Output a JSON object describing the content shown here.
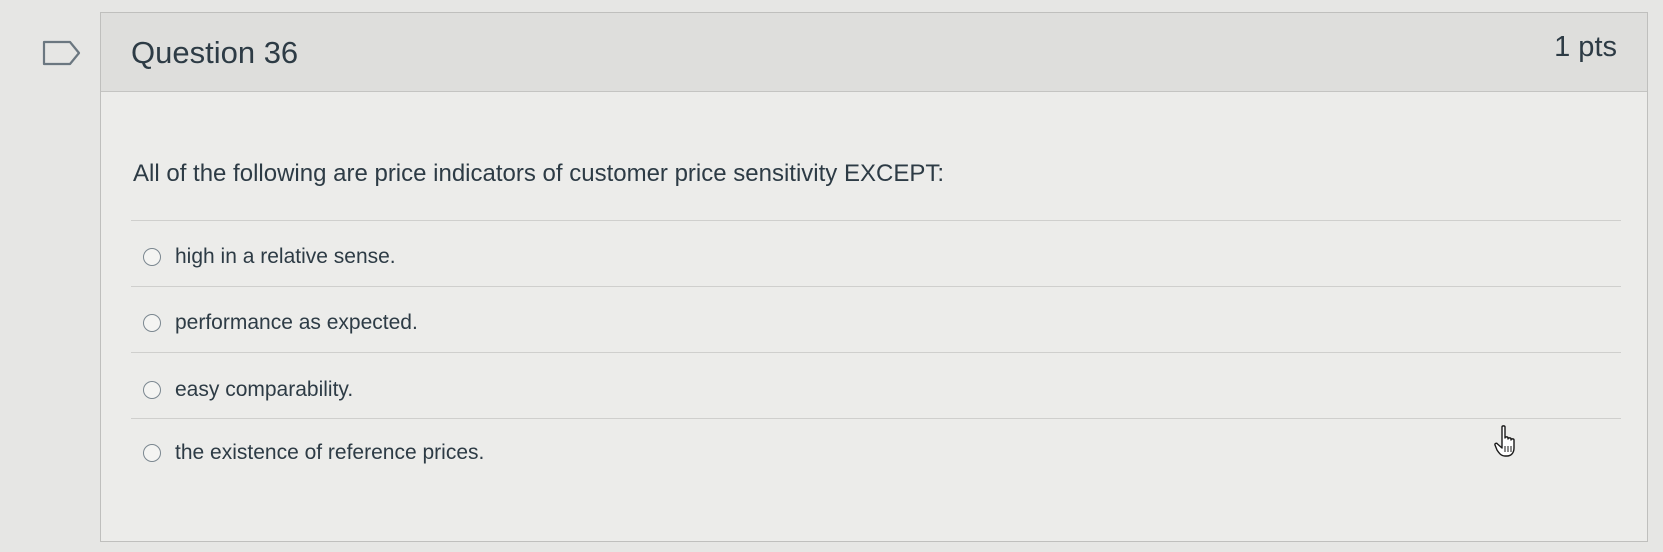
{
  "question": {
    "title": "Question 36",
    "points": "1 pts",
    "prompt": "All of the following are price indicators of customer price sensitivity EXCEPT:",
    "answers": [
      {
        "label": "high in a relative sense."
      },
      {
        "label": "performance as expected."
      },
      {
        "label": "easy comparability."
      },
      {
        "label": "the existence of reference prices."
      }
    ]
  },
  "icons": {
    "flag": "flag-outline-icon",
    "cursor": "hand-pointer-icon"
  },
  "colors": {
    "text": "#2d3b45",
    "header_bg": "#dededc",
    "page_bg": "#e6e6e4"
  }
}
